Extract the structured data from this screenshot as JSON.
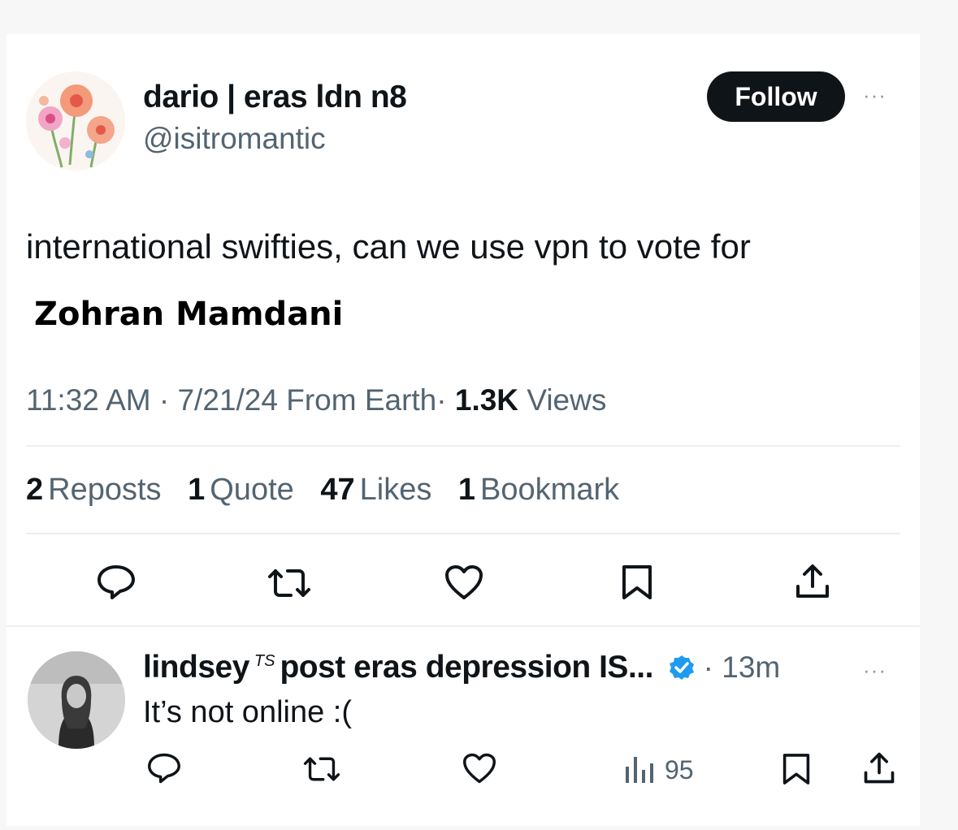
{
  "post": {
    "display_name": "dario | eras ldn n8",
    "handle": "@isitromantic",
    "follow_label": "Follow",
    "more_label": "···",
    "text": "international swifties, can we use vpn to vote for",
    "overlay_text": "Zohran Mamdani",
    "time": "11:32 AM",
    "date": "7/21/24",
    "source": "From Earth",
    "views_count": "1.3K",
    "views_label": "Views",
    "sep": "·"
  },
  "stats": [
    {
      "num": "2",
      "label": "Reposts"
    },
    {
      "num": "1",
      "label": "Quote"
    },
    {
      "num": "47",
      "label": "Likes"
    },
    {
      "num": "1",
      "label": "Bookmark"
    }
  ],
  "actions": [
    "reply-icon",
    "repost-icon",
    "like-icon",
    "bookmark-icon",
    "share-icon"
  ],
  "reply": {
    "name": "lindsey",
    "ts_mark": "TS",
    "name_rest": "post eras depression IS...",
    "time": "· 13m",
    "text": "It’s not online :(",
    "more_label": "···",
    "views": "95",
    "verified_color": "#1d9bf0"
  },
  "colors": {
    "text": "#0f1419",
    "secondary": "#536471",
    "follow_bg": "#0f1419",
    "divider": "#eceff1"
  }
}
